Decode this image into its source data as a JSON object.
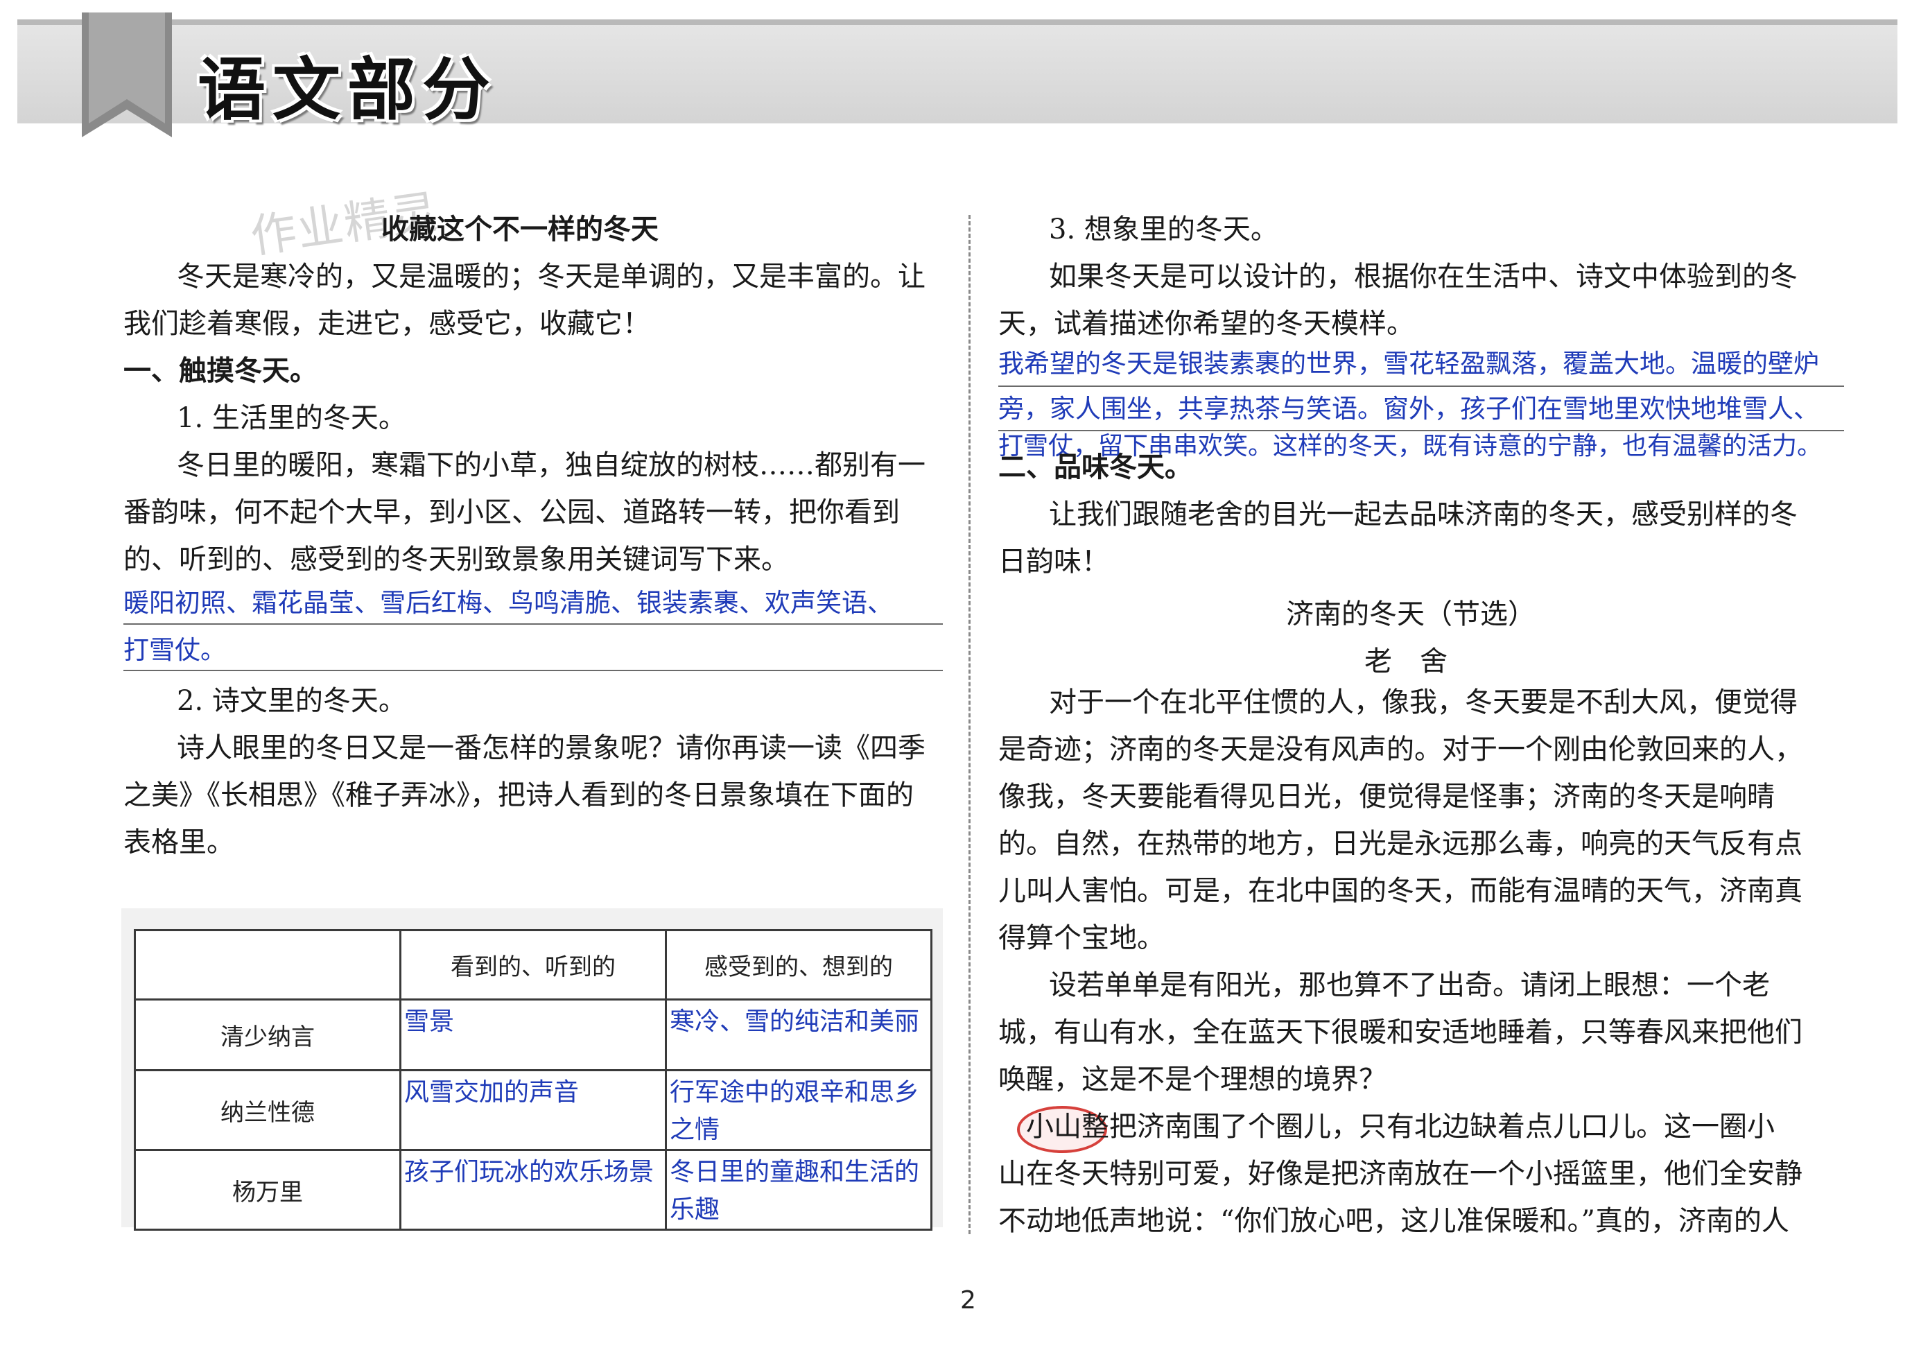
{
  "header": {
    "section_title": "语文部分"
  },
  "watermark": "作业精灵",
  "left": {
    "title": "收藏这个不一样的冬天",
    "intro": [
      "冬天是寒冷的，又是温暖的；冬天是单调的，又是丰富的。让",
      "我们趁着寒假，走进它，感受它，收藏它！"
    ],
    "section1": "一、触摸冬天。",
    "q1_title": "1. 生活里的冬天。",
    "q1_text": [
      "冬日里的暖阳，寒霜下的小草，独自绽放的树枝……都别有一",
      "番韵味，何不起个大早，到小区、公园、道路转一转，把你看到",
      "的、听到的、感受到的冬天别致景象用关键词写下来。"
    ],
    "q1_answer": [
      "暖阳初照、霜花晶莹、雪后红梅、鸟鸣清脆、银装素裹、欢声笑语、",
      "打雪仗。"
    ],
    "q2_title": "2. 诗文里的冬天。",
    "q2_text": [
      "诗人眼里的冬日又是一番怎样的景象呢？请你再读一读《四季",
      "之美》《长相思》《稚子弄冰》，把诗人看到的冬日景象填在下面的",
      "表格里。"
    ],
    "table": {
      "headers": [
        "",
        "看到的、听到的",
        "感受到的、想到的"
      ],
      "rows": [
        {
          "name": "清少纳言",
          "seen": "雪景",
          "felt": "寒冷、雪的纯洁和美丽"
        },
        {
          "name": "纳兰性德",
          "seen": "风雪交加的声音",
          "felt": "行军途中的艰辛和思乡之情"
        },
        {
          "name": "杨万里",
          "seen": "孩子们玩冰的欢乐场景",
          "felt": "冬日里的童趣和生活的乐趣"
        }
      ]
    }
  },
  "right": {
    "q3_title": "3. 想象里的冬天。",
    "q3_text": [
      "如果冬天是可以设计的，根据你在生活中、诗文中体验到的冬",
      "天，试着描述你希望的冬天模样。"
    ],
    "q3_answer": [
      "我希望的冬天是银装素裹的世界，雪花轻盈飘落，覆盖大地。温暖的壁炉",
      "旁，家人围坐，共享热茶与笑语。窗外，孩子们在雪地里欢快地堆雪人、",
      "打雪仗，留下串串欢笑。这样的冬天，既有诗意的宁静，也有温馨的活力。"
    ],
    "section2": "二、品味冬天。",
    "section2_text": [
      "让我们跟随老舍的目光一起去品味济南的冬天，感受别样的冬",
      "日韵味！"
    ],
    "essay_title": "济南的冬天（节选）",
    "author": "老　舍",
    "paragraphs": [
      [
        "对于一个在北平住惯的人，像我，冬天要是不刮大风，便觉得",
        "是奇迹；济南的冬天是没有风声的。对于一个刚由伦敦回来的人，",
        "像我，冬天要能看得见日光，便觉得是怪事；济南的冬天是响晴",
        "的。自然，在热带的地方，日光是永远那么毒，响亮的天气反有点",
        "儿叫人害怕。可是，在北中国的冬天，而能有温晴的天气，济南真",
        "得算个宝地。"
      ],
      [
        "设若单单是有阳光，那也算不了出奇。请闭上眼想：一个老",
        "城，有山有水，全在蓝天下很暖和安适地睡着，只等春风来把他们",
        "唤醒，这是不是个理想的境界？"
      ],
      [
        "小山整把济南围了个圈儿，只有北边缺着点儿口儿。这一圈小",
        "山在冬天特别可爱，好像是把济南放在一个小摇篮里，他们全安静",
        "不动地低声地说：“你们放心吧，这儿准保暖和。”真的，济南的人"
      ]
    ]
  },
  "page_number": "2"
}
